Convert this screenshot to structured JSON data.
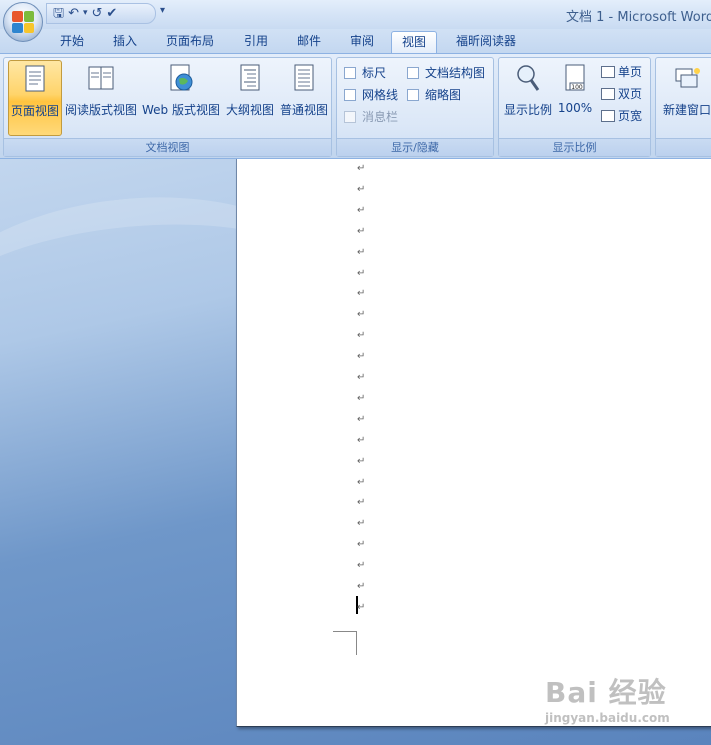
{
  "window": {
    "title": "文档 1 - Microsoft Word"
  },
  "tabs": [
    "开始",
    "插入",
    "页面布局",
    "引用",
    "邮件",
    "审阅",
    "视图",
    "福昕阅读器"
  ],
  "active_tab": "视图",
  "groups": {
    "document_views": {
      "label": "文档视图",
      "buttons": [
        "页面视图",
        "阅读版式视图",
        "Web 版式视图",
        "大纲视图",
        "普通视图"
      ],
      "selected": "页面视图"
    },
    "show_hide": {
      "label": "显示/隐藏",
      "checkboxes": [
        "标尺",
        "网格线",
        "消息栏",
        "文档结构图",
        "缩略图"
      ]
    },
    "zoom": {
      "label": "显示比例",
      "zoom_button": "显示比例",
      "percent_button": "100%",
      "percent_icon_text": "100",
      "small_buttons": [
        "单页",
        "双页",
        "页宽"
      ]
    },
    "window": {
      "new_window": "新建窗口"
    }
  },
  "document": {
    "paragraph_mark": "↵"
  },
  "watermark": {
    "main": "Bai 经验",
    "sub": "jingyan.baidu.com"
  },
  "colors": {
    "accent": "#15428b",
    "selected_button": "#ffd46b",
    "page": "#ffffff"
  },
  "icons": [
    "office-button-icon",
    "save-icon",
    "undo-icon",
    "redo-icon",
    "spelling-icon"
  ]
}
